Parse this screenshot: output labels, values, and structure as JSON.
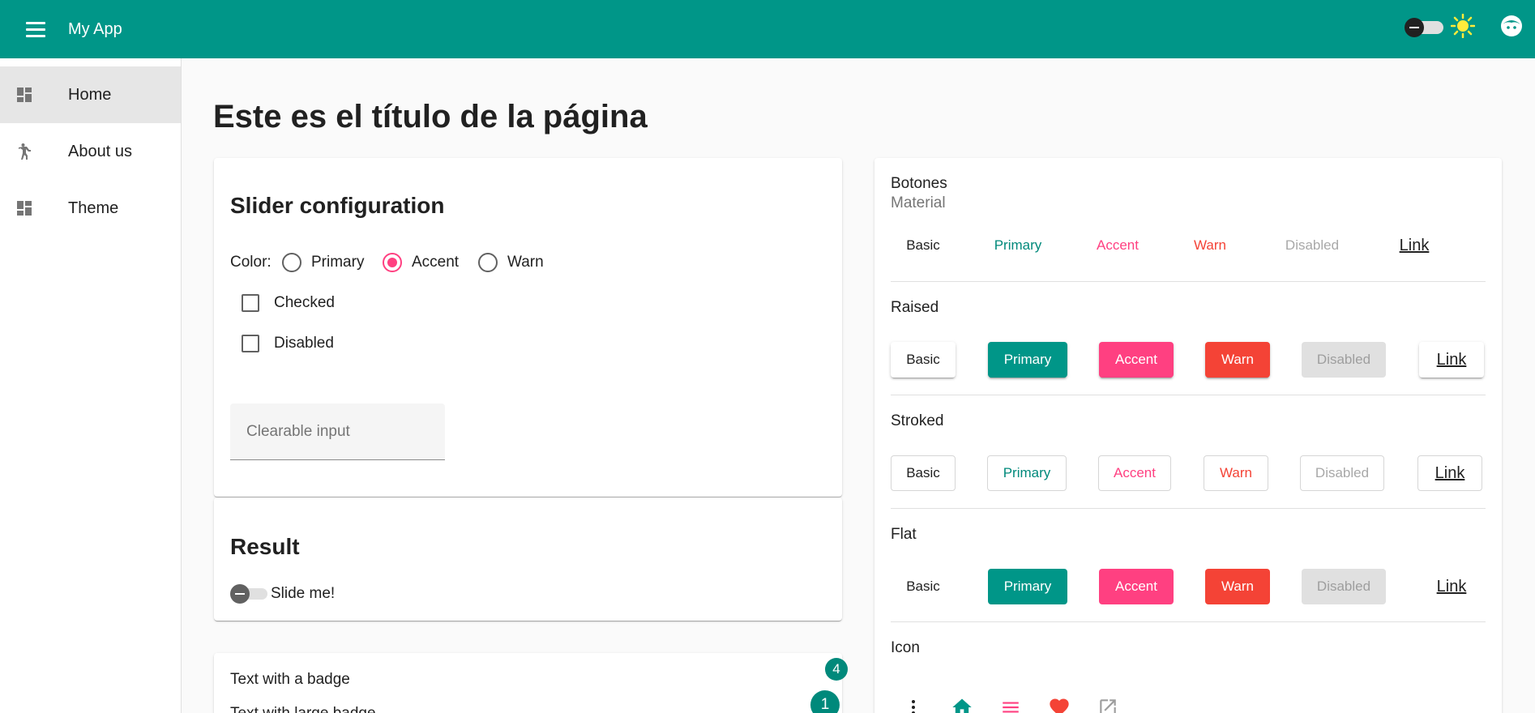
{
  "toolbar": {
    "title": "My App",
    "menu_icon": "menu-icon",
    "theme_toggle_icon": "toggle-icon",
    "sun_icon": "sun-icon",
    "avatar_icon": "avatar-icon",
    "color": "#009688"
  },
  "sidebar": {
    "items": [
      {
        "label": "Home",
        "icon": "dashboard-icon",
        "active": true
      },
      {
        "label": "About us",
        "icon": "accessibility-icon",
        "active": false
      },
      {
        "label": "Theme",
        "icon": "dashboard-icon",
        "active": false
      }
    ]
  },
  "main": {
    "page_title": "Este es el título de la página",
    "slider_card": {
      "title": "Slider configuration",
      "color_label": "Color:",
      "radios": [
        "Primary",
        "Accent",
        "Warn"
      ],
      "selected_radio": "Accent",
      "checkboxes": [
        "Checked",
        "Disabled"
      ],
      "input_placeholder": "Clearable input",
      "input_value": ""
    },
    "result_card": {
      "title": "Result",
      "toggle_label": "Slide me!"
    },
    "badge_card": {
      "text_badge": "Text with a badge",
      "badge_value": "4",
      "text_large_badge": "Text with large badge",
      "large_badge_value": "1"
    },
    "buttons_card": {
      "header_title": "Botones",
      "header_subtitle": "Material",
      "basic_row": [
        "Basic",
        "Primary",
        "Accent",
        "Warn",
        "Disabled",
        "Link"
      ],
      "raised_title": "Raised",
      "raised_row": [
        "Basic",
        "Primary",
        "Accent",
        "Warn",
        "Disabled",
        "Link"
      ],
      "stroked_title": "Stroked",
      "stroked_row": [
        "Basic",
        "Primary",
        "Accent",
        "Warn",
        "Disabled",
        "Link"
      ],
      "flat_title": "Flat",
      "flat_row": [
        "Basic",
        "Primary",
        "Accent",
        "Warn",
        "Disabled",
        "Link"
      ],
      "icon_title": "Icon",
      "icons": [
        "more-vert-icon",
        "home-icon",
        "menu-icon",
        "favorite-icon",
        "open-in-new-icon"
      ]
    }
  },
  "colors": {
    "primary": "#009688",
    "accent": "#ff4081",
    "warn": "#f44336"
  }
}
